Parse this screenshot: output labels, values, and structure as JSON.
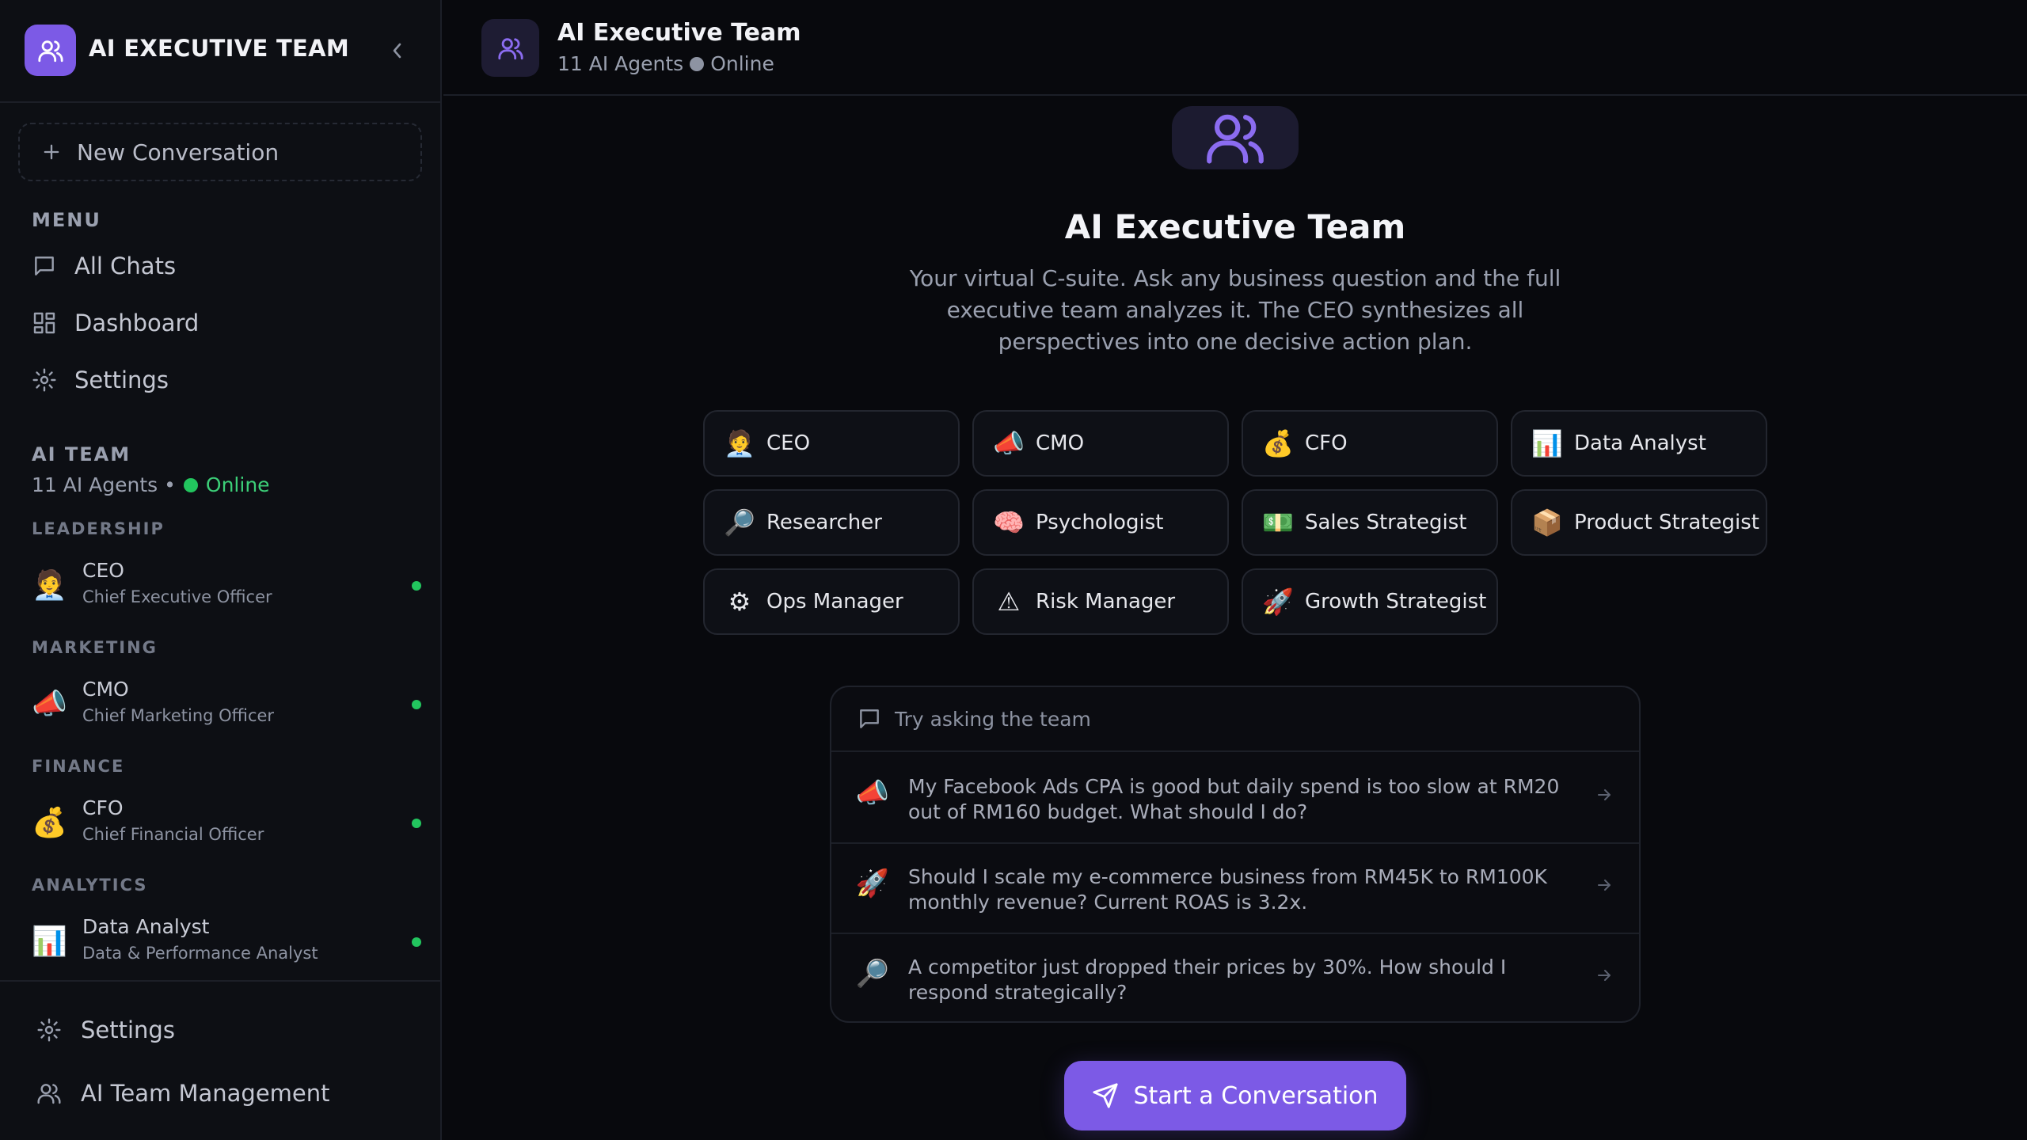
{
  "brand": {
    "title": "AI EXECUTIVE TEAM"
  },
  "sidebar": {
    "new_conversation": "New Conversation",
    "menu_label": "MENU",
    "menu_items": [
      {
        "label": "All Chats",
        "icon": "chat-icon"
      },
      {
        "label": "Dashboard",
        "icon": "dashboard-icon"
      },
      {
        "label": "Settings",
        "icon": "gear-icon"
      }
    ],
    "team_label": "AI TEAM",
    "team_count": "11 AI Agents •",
    "team_status": "Online",
    "categories": [
      {
        "label": "LEADERSHIP",
        "agent": {
          "emoji": "🧑‍💼",
          "name": "CEO",
          "role": "Chief Executive Officer"
        }
      },
      {
        "label": "MARKETING",
        "agent": {
          "emoji": "📣",
          "name": "CMO",
          "role": "Chief Marketing Officer"
        }
      },
      {
        "label": "FINANCE",
        "agent": {
          "emoji": "💰",
          "name": "CFO",
          "role": "Chief Financial Officer"
        }
      },
      {
        "label": "ANALYTICS",
        "agent": {
          "emoji": "📊",
          "name": "Data Analyst",
          "role": "Data & Performance Analyst"
        }
      }
    ],
    "footer": [
      {
        "label": "Settings",
        "icon": "gear-icon"
      },
      {
        "label": "AI Team Management",
        "icon": "users-icon"
      }
    ]
  },
  "header": {
    "title": "AI Executive Team",
    "agents_count": "11 AI Agents",
    "status": "Online"
  },
  "hero": {
    "title": "AI Executive Team",
    "description": "Your virtual C-suite. Ask any business question and the full executive team analyzes it. The CEO synthesizes all perspectives into one decisive action plan."
  },
  "agents": [
    {
      "emoji": "🧑‍💼",
      "label": "CEO"
    },
    {
      "emoji": "📣",
      "label": "CMO"
    },
    {
      "emoji": "💰",
      "label": "CFO"
    },
    {
      "emoji": "📊",
      "label": "Data Analyst"
    },
    {
      "emoji": "🔎",
      "label": "Researcher"
    },
    {
      "emoji": "🧠",
      "label": "Psychologist"
    },
    {
      "emoji": "💵",
      "label": "Sales Strategist"
    },
    {
      "emoji": "📦",
      "label": "Product Strategist"
    },
    {
      "emoji": "⚙",
      "label": "Ops Manager"
    },
    {
      "emoji": "⚠",
      "label": "Risk Manager"
    },
    {
      "emoji": "🚀",
      "label": "Growth Strategist"
    }
  ],
  "suggestions": {
    "heading": "Try asking the team",
    "items": [
      {
        "emoji": "📣",
        "text": "My Facebook Ads CPA is good but daily spend is too slow at RM20 out of RM160 budget. What should I do?"
      },
      {
        "emoji": "🚀",
        "text": "Should I scale my e-commerce business from RM45K to RM100K monthly revenue? Current ROAS is 3.2x."
      },
      {
        "emoji": "🔎",
        "text": "A competitor just dropped their prices by 30%. How should I respond strategically?"
      }
    ]
  },
  "cta": {
    "label": "Start a Conversation"
  },
  "colors": {
    "accent": "#7c5ae6",
    "online": "#22c55e",
    "background": "#08090d",
    "sidebar": "#0d0f14"
  }
}
